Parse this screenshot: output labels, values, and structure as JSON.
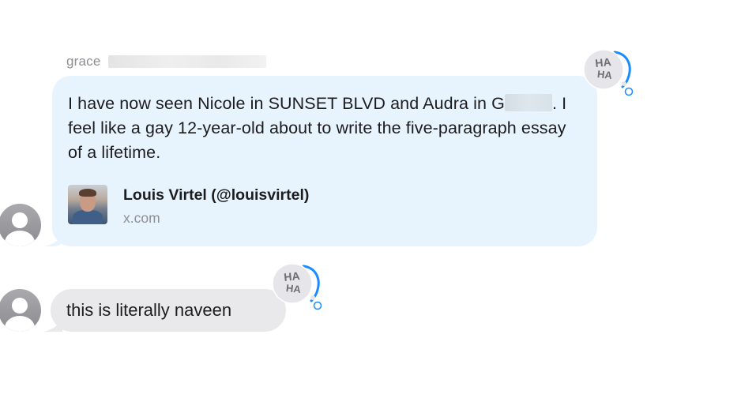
{
  "conversation": {
    "messages": [
      {
        "sender_visible": "grace",
        "text_before_redaction": "I have now seen Nicole in SUNSET BLVD and Audra in G",
        "text_after_redaction": ". I feel like a gay 12-year-old about to write the five-paragraph essay of a lifetime.",
        "reaction": {
          "icon": "haha-tapback-icon",
          "label_top": "HA",
          "label_bottom": "HA"
        },
        "link_preview": {
          "title": "Louis Virtel (@louisvirtel)",
          "domain": "x.com",
          "thumbnail": "profile-photo"
        }
      },
      {
        "text": "this is literally naveen",
        "reaction": {
          "icon": "haha-tapback-icon",
          "label_top": "HA",
          "label_bottom": "HA"
        }
      }
    ]
  },
  "colors": {
    "incoming_bubble": "#e9e9eb",
    "highlighted_bubble": "#e8f4fd",
    "tapback_accent": "#1a8cff",
    "tapback_fill": "#e5e5ea",
    "secondary_text": "#8e8e93"
  }
}
